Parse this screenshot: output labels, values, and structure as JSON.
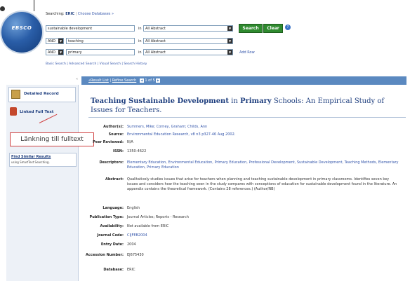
{
  "search": {
    "searching_label": "Searching:",
    "database": "ERIC",
    "choose_databases": "Choose Databases »",
    "rows": [
      {
        "bool": "",
        "term": "sustainable development",
        "in_label": "in",
        "field": "All Abstract"
      },
      {
        "bool": "AND",
        "term": "teaching",
        "in_label": "in",
        "field": "All Abstract"
      },
      {
        "bool": "AND",
        "term": "primary",
        "in_label": "in",
        "field": "All Abstract"
      }
    ],
    "search_button": "Search",
    "clear_button": "Clear",
    "add_row": "Add Row",
    "sub_links": "Basic Search  |  Advanced Search  |  Visual Search  |  Search History"
  },
  "logo_text": "EBSCO",
  "nav": {
    "result_list": "«Result List",
    "refine_search": "Refine Search",
    "page_of": "1 of 5"
  },
  "left_panel": {
    "detailed_record": "Detailed Record",
    "linked_full_text": "Linked Full Text",
    "find_similar": "Find Similar Results",
    "find_similar_sub": "using SmartText Searching."
  },
  "callout": "Länkning till fulltext",
  "record": {
    "title_part1": "Teaching Sustainable Development",
    "title_part2": " in ",
    "title_part3": "Primary",
    "title_part4": " Schools: An Empirical Study of Issues for Teachers.",
    "fields": [
      {
        "label": "Author(s):",
        "value": "Summers, Mike; Corney, Graham; Childs, Ann"
      },
      {
        "label": "Source:",
        "value": "Environmental Education Research, v8 n3 p327-46 Aug 2002."
      },
      {
        "label": "Peer Reviewed:",
        "value": "N/A"
      },
      {
        "label": "ISSN:",
        "value": "1350-4622"
      },
      {
        "label": "Descriptors:",
        "value": "Elementary Education, Environmental Education, Primary Education, Professional Development, Sustainable Development, Teaching Methods, Elementary Education, Primary Education"
      },
      {
        "label": "Abstract:",
        "value": "Qualitatively studies issues that arise for teachers when planning and teaching sustainable development in primary classrooms. Identifies seven key issues and considers how the teaching seen in the study compares with conceptions of education for sustainable development found in the literature. An appendix contains the theoretical framework. (Contains 28 references.) (Author/NB)"
      },
      {
        "label": "Language:",
        "value": "English"
      },
      {
        "label": "Publication Type:",
        "value": "Journal Articles; Reports - Research"
      },
      {
        "label": "Availability:",
        "value": "Not available from ERIC"
      },
      {
        "label": "Journal Code:",
        "value": "CIJFEB2004"
      },
      {
        "label": "Entry Date:",
        "value": "2004"
      },
      {
        "label": "Accession Number:",
        "value": "EJ675430"
      },
      {
        "label": "Database:",
        "value": "ERIC"
      }
    ]
  }
}
